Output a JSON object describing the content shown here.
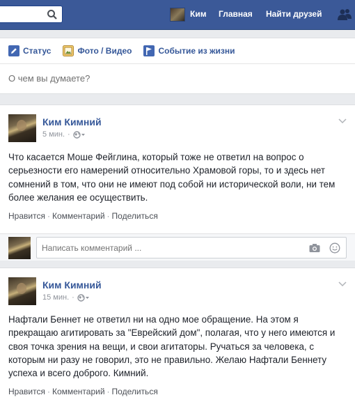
{
  "topbar": {
    "search_placeholder": "",
    "user_name": "Ким",
    "home_label": "Главная",
    "find_friends_label": "Найти друзей",
    "icons": [
      "search-icon",
      "friends-icon"
    ]
  },
  "composer": {
    "status_label": "Статус",
    "photo_label": "Фото / Видео",
    "life_event_label": "Событие из жизни",
    "placeholder": "О чем вы думаете?"
  },
  "posts": [
    {
      "author": "Ким Кимний",
      "time": "5 мин.",
      "text": "Что касается Моше Фейглина, который тоже не ответил на вопрос о серьезности его намерений относительно Храмовой горы, то и здесь нет сомнений в том, что они не имеют под собой ни исторической воли, ни тем более желания ее осуществить.",
      "like": "Нравится",
      "comment": "Комментарий",
      "share": "Поделиться",
      "comment_placeholder": "Написать комментарий ..."
    },
    {
      "author": "Ким Кимний",
      "time": "15 мин.",
      "text": "Нафтали Беннет не ответил ни на одно мое обращение. На этом я прекращаю агитировать за \"Еврейский дом\", полагая, что у него имеются и своя точка зрения на вещи, и свои агитаторы. Ручаться за человека, с которым ни разу не говорил, это не правильно. Желаю Нафтали Беннету успеха и всего доброго. Кимний.",
      "like": "Нравится",
      "comment": "Комментарий",
      "share": "Поделиться"
    }
  ],
  "colors": {
    "brand": "#3b5998",
    "link": "#365899",
    "background": "#e9ebee"
  }
}
